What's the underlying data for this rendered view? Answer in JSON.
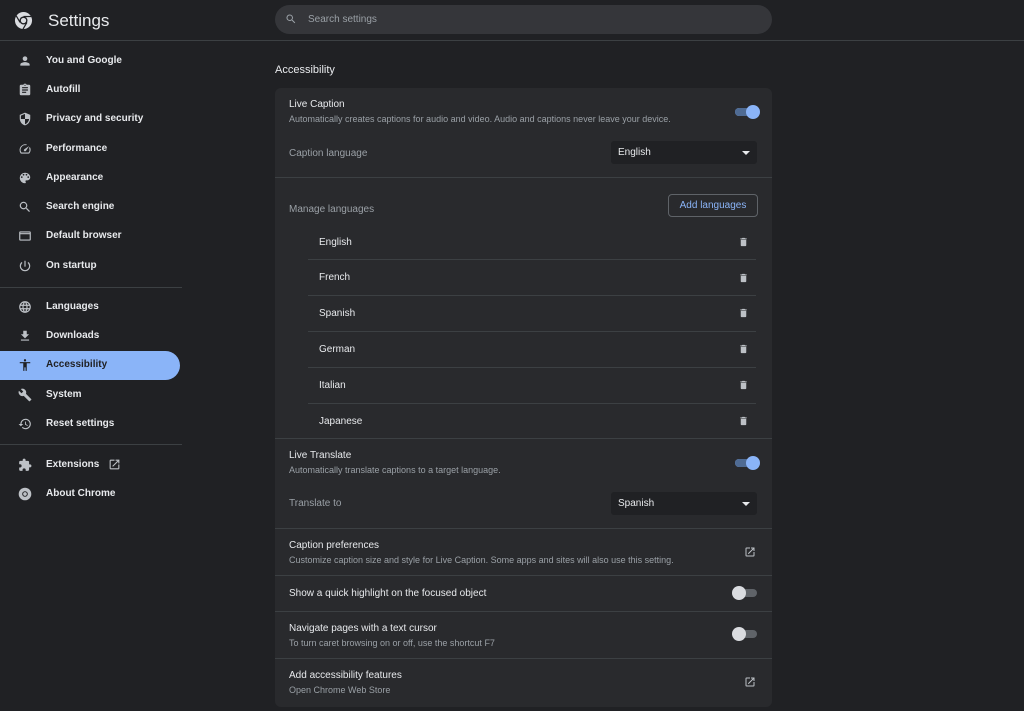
{
  "header": {
    "title": "Settings",
    "search_placeholder": "Search settings"
  },
  "sidebar": {
    "items": [
      {
        "label": "You and Google",
        "icon": "person-icon"
      },
      {
        "label": "Autofill",
        "icon": "clipboard-icon"
      },
      {
        "label": "Privacy and security",
        "icon": "shield-icon"
      },
      {
        "label": "Performance",
        "icon": "speedometer-icon"
      },
      {
        "label": "Appearance",
        "icon": "palette-icon"
      },
      {
        "label": "Search engine",
        "icon": "search-icon"
      },
      {
        "label": "Default browser",
        "icon": "browser-window-icon"
      },
      {
        "label": "On startup",
        "icon": "power-icon"
      },
      {
        "label": "Languages",
        "icon": "globe-icon"
      },
      {
        "label": "Downloads",
        "icon": "download-icon"
      },
      {
        "label": "Accessibility",
        "icon": "accessibility-icon",
        "active": true
      },
      {
        "label": "System",
        "icon": "wrench-icon"
      },
      {
        "label": "Reset settings",
        "icon": "history-icon"
      },
      {
        "label": "Extensions",
        "icon": "puzzle-icon"
      },
      {
        "label": "About Chrome",
        "icon": "chrome-icon"
      }
    ]
  },
  "main": {
    "section_title": "Accessibility",
    "live_caption": {
      "title": "Live Caption",
      "subtitle": "Automatically creates captions for audio and video. Audio and captions never leave your device.",
      "enabled": true,
      "caption_language_label": "Caption language",
      "caption_language_value": "English"
    },
    "manage_languages": {
      "label": "Manage languages",
      "add_button": "Add languages",
      "languages": [
        "English",
        "French",
        "Spanish",
        "German",
        "Italian",
        "Japanese"
      ]
    },
    "live_translate": {
      "title": "Live Translate",
      "subtitle": "Automatically translate captions to a target language.",
      "enabled": true,
      "translate_to_label": "Translate to",
      "translate_to_value": "Spanish"
    },
    "caption_preferences": {
      "title": "Caption preferences",
      "subtitle": "Customize caption size and style for Live Caption. Some apps and sites will also use this setting."
    },
    "quick_highlight": {
      "title": "Show a quick highlight on the focused object",
      "enabled": false
    },
    "text_cursor": {
      "title": "Navigate pages with a text cursor",
      "subtitle": "To turn caret browsing on or off, use the shortcut F7",
      "enabled": false
    },
    "add_features": {
      "title": "Add accessibility features",
      "subtitle": "Open Chrome Web Store"
    }
  }
}
